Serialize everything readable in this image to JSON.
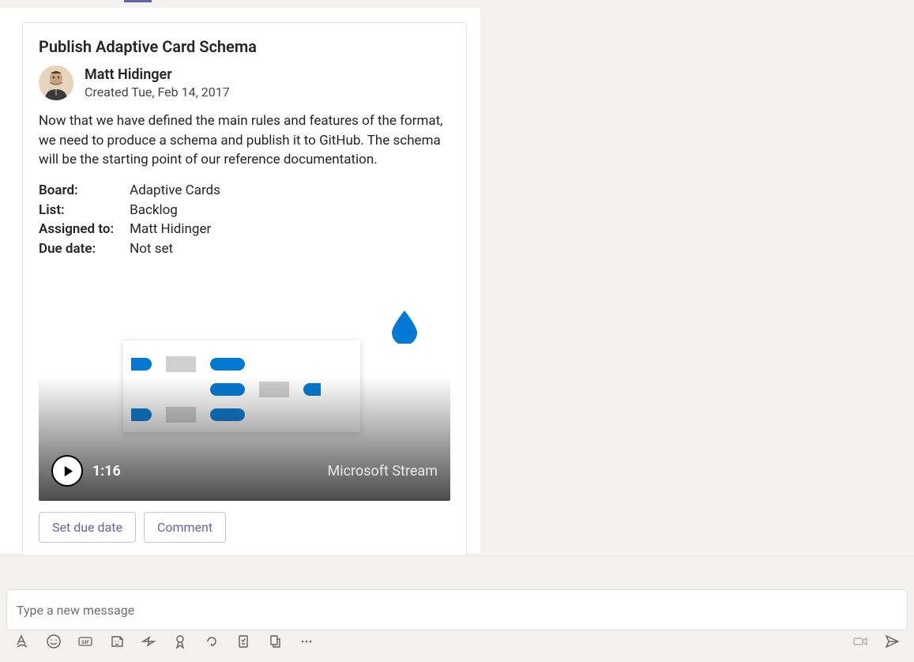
{
  "card": {
    "title": "Publish Adaptive Card Schema",
    "creator": {
      "name": "Matt Hidinger",
      "subtitle": "Created Tue, Feb 14, 2017"
    },
    "body": "Now that we have defined the main rules and features of the format, we need to produce a schema and publish it to GitHub. The schema will be the starting point of our reference documentation.",
    "facts": {
      "board_label": "Board:",
      "board_value": "Adaptive Cards",
      "list_label": "List:",
      "list_value": "Backlog",
      "assigned_label": "Assigned to:",
      "assigned_value": "Matt Hidinger",
      "due_label": "Due date:",
      "due_value": "Not set"
    },
    "video": {
      "duration": "1:16",
      "source": "Microsoft Stream"
    },
    "actions": {
      "set_due": "Set due date",
      "comment": "Comment"
    }
  },
  "compose": {
    "placeholder": "Type a new message"
  },
  "colors": {
    "accent": "#6264a7",
    "ms_blue": "#0078d4"
  }
}
